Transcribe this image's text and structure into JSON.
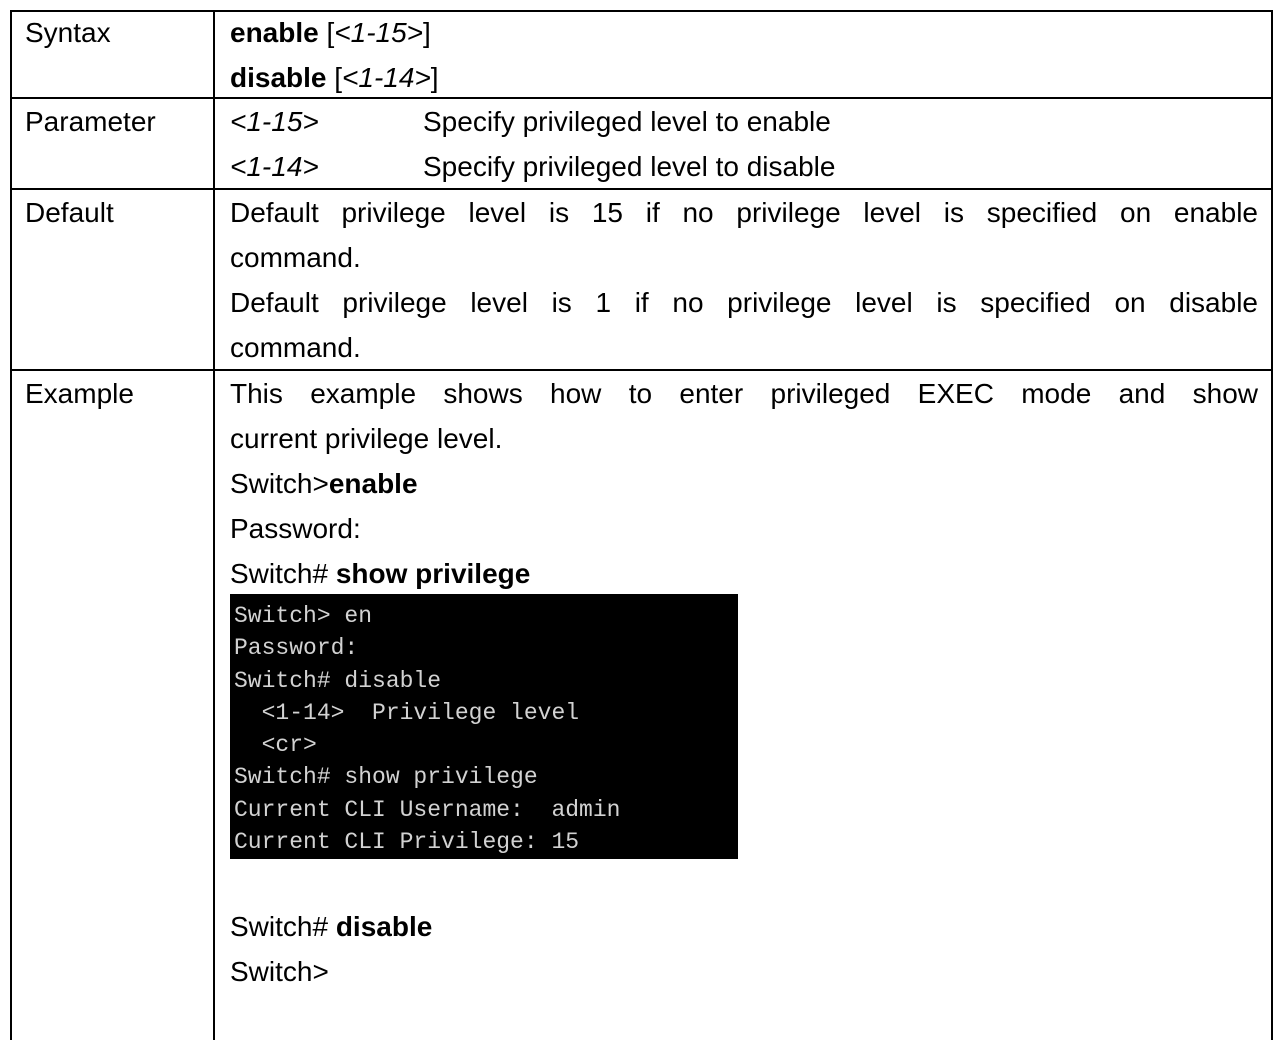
{
  "rows": {
    "syntax": {
      "label": "Syntax",
      "enable_cmd": "enable",
      "enable_open": " [",
      "enable_arg": "<1-15>",
      "enable_close": "]",
      "disable_cmd": "disable",
      "disable_open": " [",
      "disable_arg": "<1-14>",
      "disable_close": "]"
    },
    "parameter": {
      "label": "Parameter",
      "items": [
        {
          "name": "<1-15>",
          "desc": "Specify privileged level to enable"
        },
        {
          "name": "<1-14>",
          "desc": "Specify privileged level to disable"
        }
      ]
    },
    "default": {
      "label": "Default",
      "lines": [
        "Default privilege level is 15 if no privilege level is specified on enable",
        "command.",
        "Default privilege level is 1 if no privilege level is specified on disable",
        "command."
      ]
    },
    "example": {
      "label": "Example",
      "intro_line1": "This example shows how to enter privileged EXEC mode and show",
      "intro_line2": "current privilege level.",
      "cmd1_prompt": "Switch>",
      "cmd1_cmd": "enable",
      "password": "Password:",
      "cmd2_prompt": "Switch# ",
      "cmd2_cmd": "show privilege",
      "terminal_lines": [
        "Switch> en",
        "Password:",
        "Switch# disable",
        "  <1-14>  Privilege level",
        "  <cr>",
        "Switch# show privilege",
        "Current CLI Username:  admin",
        "Current CLI Privilege: 15"
      ],
      "cmd3_prompt": "Switch# ",
      "cmd3_cmd": "disable",
      "final_prompt": "Switch>"
    }
  }
}
